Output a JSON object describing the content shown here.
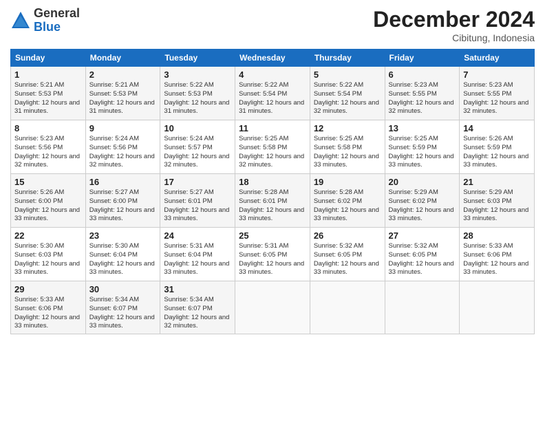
{
  "logo": {
    "general": "General",
    "blue": "Blue"
  },
  "title": "December 2024",
  "location": "Cibitung, Indonesia",
  "weekdays": [
    "Sunday",
    "Monday",
    "Tuesday",
    "Wednesday",
    "Thursday",
    "Friday",
    "Saturday"
  ],
  "weeks": [
    [
      {
        "day": "1",
        "sunrise": "5:21 AM",
        "sunset": "5:53 PM",
        "daylight": "12 hours and 31 minutes."
      },
      {
        "day": "2",
        "sunrise": "5:21 AM",
        "sunset": "5:53 PM",
        "daylight": "12 hours and 31 minutes."
      },
      {
        "day": "3",
        "sunrise": "5:22 AM",
        "sunset": "5:53 PM",
        "daylight": "12 hours and 31 minutes."
      },
      {
        "day": "4",
        "sunrise": "5:22 AM",
        "sunset": "5:54 PM",
        "daylight": "12 hours and 31 minutes."
      },
      {
        "day": "5",
        "sunrise": "5:22 AM",
        "sunset": "5:54 PM",
        "daylight": "12 hours and 32 minutes."
      },
      {
        "day": "6",
        "sunrise": "5:23 AM",
        "sunset": "5:55 PM",
        "daylight": "12 hours and 32 minutes."
      },
      {
        "day": "7",
        "sunrise": "5:23 AM",
        "sunset": "5:55 PM",
        "daylight": "12 hours and 32 minutes."
      }
    ],
    [
      {
        "day": "8",
        "sunrise": "5:23 AM",
        "sunset": "5:56 PM",
        "daylight": "12 hours and 32 minutes."
      },
      {
        "day": "9",
        "sunrise": "5:24 AM",
        "sunset": "5:56 PM",
        "daylight": "12 hours and 32 minutes."
      },
      {
        "day": "10",
        "sunrise": "5:24 AM",
        "sunset": "5:57 PM",
        "daylight": "12 hours and 32 minutes."
      },
      {
        "day": "11",
        "sunrise": "5:25 AM",
        "sunset": "5:58 PM",
        "daylight": "12 hours and 32 minutes."
      },
      {
        "day": "12",
        "sunrise": "5:25 AM",
        "sunset": "5:58 PM",
        "daylight": "12 hours and 33 minutes."
      },
      {
        "day": "13",
        "sunrise": "5:25 AM",
        "sunset": "5:59 PM",
        "daylight": "12 hours and 33 minutes."
      },
      {
        "day": "14",
        "sunrise": "5:26 AM",
        "sunset": "5:59 PM",
        "daylight": "12 hours and 33 minutes."
      }
    ],
    [
      {
        "day": "15",
        "sunrise": "5:26 AM",
        "sunset": "6:00 PM",
        "daylight": "12 hours and 33 minutes."
      },
      {
        "day": "16",
        "sunrise": "5:27 AM",
        "sunset": "6:00 PM",
        "daylight": "12 hours and 33 minutes."
      },
      {
        "day": "17",
        "sunrise": "5:27 AM",
        "sunset": "6:01 PM",
        "daylight": "12 hours and 33 minutes."
      },
      {
        "day": "18",
        "sunrise": "5:28 AM",
        "sunset": "6:01 PM",
        "daylight": "12 hours and 33 minutes."
      },
      {
        "day": "19",
        "sunrise": "5:28 AM",
        "sunset": "6:02 PM",
        "daylight": "12 hours and 33 minutes."
      },
      {
        "day": "20",
        "sunrise": "5:29 AM",
        "sunset": "6:02 PM",
        "daylight": "12 hours and 33 minutes."
      },
      {
        "day": "21",
        "sunrise": "5:29 AM",
        "sunset": "6:03 PM",
        "daylight": "12 hours and 33 minutes."
      }
    ],
    [
      {
        "day": "22",
        "sunrise": "5:30 AM",
        "sunset": "6:03 PM",
        "daylight": "12 hours and 33 minutes."
      },
      {
        "day": "23",
        "sunrise": "5:30 AM",
        "sunset": "6:04 PM",
        "daylight": "12 hours and 33 minutes."
      },
      {
        "day": "24",
        "sunrise": "5:31 AM",
        "sunset": "6:04 PM",
        "daylight": "12 hours and 33 minutes."
      },
      {
        "day": "25",
        "sunrise": "5:31 AM",
        "sunset": "6:05 PM",
        "daylight": "12 hours and 33 minutes."
      },
      {
        "day": "26",
        "sunrise": "5:32 AM",
        "sunset": "6:05 PM",
        "daylight": "12 hours and 33 minutes."
      },
      {
        "day": "27",
        "sunrise": "5:32 AM",
        "sunset": "6:05 PM",
        "daylight": "12 hours and 33 minutes."
      },
      {
        "day": "28",
        "sunrise": "5:33 AM",
        "sunset": "6:06 PM",
        "daylight": "12 hours and 33 minutes."
      }
    ],
    [
      {
        "day": "29",
        "sunrise": "5:33 AM",
        "sunset": "6:06 PM",
        "daylight": "12 hours and 33 minutes."
      },
      {
        "day": "30",
        "sunrise": "5:34 AM",
        "sunset": "6:07 PM",
        "daylight": "12 hours and 33 minutes."
      },
      {
        "day": "31",
        "sunrise": "5:34 AM",
        "sunset": "6:07 PM",
        "daylight": "12 hours and 32 minutes."
      },
      null,
      null,
      null,
      null
    ]
  ]
}
